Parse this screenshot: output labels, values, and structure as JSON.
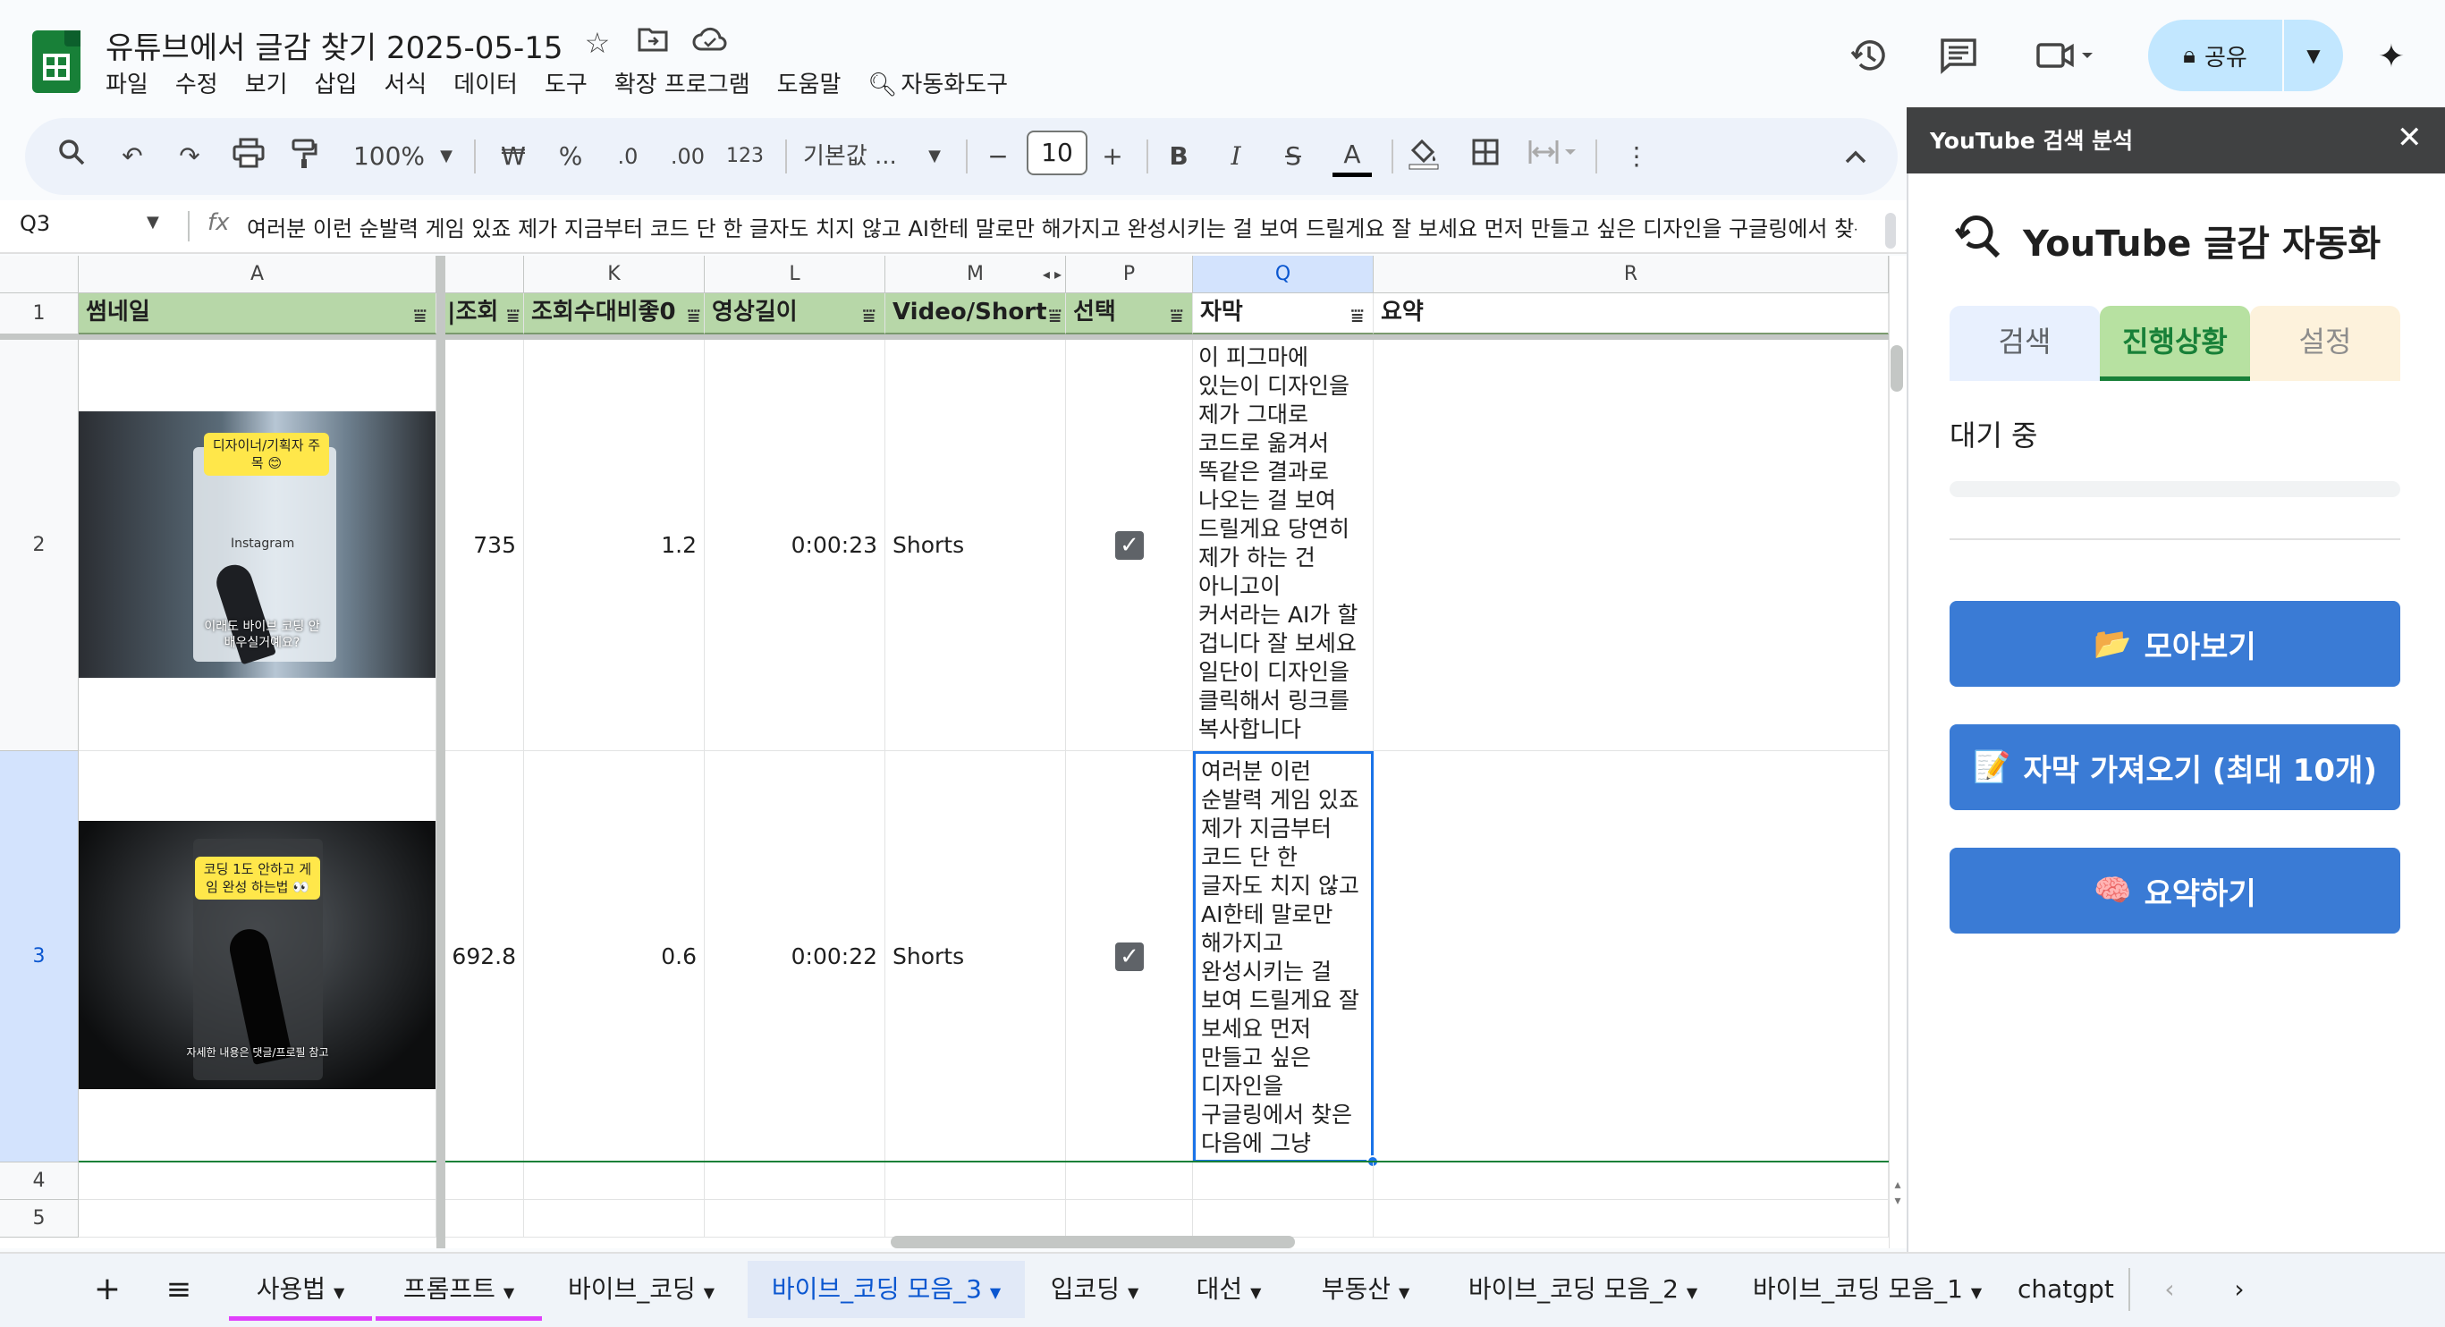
{
  "app": {
    "doc_title": "유튜브에서 글감 찾기 2025-05-15",
    "menu": [
      "파일",
      "수정",
      "보기",
      "삽입",
      "서식",
      "데이터",
      "도구",
      "확장 프로그램",
      "도움말",
      "자동화도구"
    ],
    "share_label": "공유"
  },
  "toolbar": {
    "zoom": "100%",
    "currency": "₩",
    "percent": "%",
    "dec_decrease": ".0",
    "dec_increase": ".00",
    "number_format": "123",
    "font": "기본값 ...",
    "font_size": "10",
    "bold": "B",
    "italic": "I",
    "strike": "S",
    "text_color": "A"
  },
  "formula_bar": {
    "cell_ref": "Q3",
    "fx": "fx",
    "content": "여러분 이런 순발력 게임 있죠 제가 지금부터 코드 단 한 글자도 치지 않고 AI한테 말로만 해가지고 완성시키는 걸 보여 드릴게요 잘 보세요 먼저 만들고 싶은 디자인을 구글링에서 찾은 다음에 그냥"
  },
  "columns": [
    "A",
    "K",
    "L",
    "M",
    "P",
    "Q",
    "R"
  ],
  "rows": [
    "1",
    "2",
    "3",
    "4",
    "5"
  ],
  "header_row": {
    "A": "썸네일",
    "J": "|조회",
    "K": "조회수대비좋0",
    "L": "영상길이",
    "M": "Video/Short",
    "P": "선택",
    "Q": "자막",
    "R": "요약"
  },
  "data_rows": [
    {
      "J": "735",
      "K": "1.2",
      "L": "0:00:23",
      "M": "Shorts",
      "P_checked": true,
      "Q": "이 피그마에 있는이 디자인을 제가 그대로 코드로 옮겨서 똑같은 결과로 나오는 걸 보여 드릴게요 당연히 제가 하는 건 아니고이 커서라는 AI가 할 겁니다 잘 보세요 일단이 디자인을 클릭해서 링크를 복사합니다",
      "thumb_badge": "디자이너/기획자 주목 😊",
      "thumb_caption": "이래도 바이브 코딩 안 배우실거예요?",
      "thumb_logo": "Instagram"
    },
    {
      "J": "692.8",
      "K": "0.6",
      "L": "0:00:22",
      "M": "Shorts",
      "P_checked": true,
      "Q": "여러분 이런 순발력 게임 있죠 제가 지금부터 코드 단 한 글자도 치지 않고 AI한테 말로만 해가지고 완성시키는 걸 보여 드릴게요 잘 보세요 먼저 만들고 싶은 디자인을 구글링에서 찾은 다음에 그냥 복사를 합니다",
      "thumb_badge": "코딩 1도 안하고 게임 완성 하는법 👀",
      "thumb_caption": "자세한 내용은 댓글/프로필 참고"
    }
  ],
  "sheet_tabs": [
    "사용법",
    "프롬프트",
    "바이브_코딩",
    "바이브_코딩 모음_3",
    "입코딩",
    "대선",
    "부동산",
    "바이브_코딩 모음_2",
    "바이브_코딩 모음_1",
    "chatgpt"
  ],
  "active_tab": "바이브_코딩 모음_3",
  "colors": {
    "accent": "#0b57d0",
    "header_green": "#b7d7a8",
    "tab_underline": "#e040fb",
    "panel_button": "#3a7bd5"
  },
  "panel": {
    "header": "YouTube 검색 분석",
    "title": "YouTube 글감 자동화",
    "tabs": [
      "검색",
      "진행상황",
      "설정"
    ],
    "active_tab": "진행상황",
    "status": "대기 중",
    "progress": 0,
    "buttons": [
      {
        "icon": "📂",
        "label": "모아보기"
      },
      {
        "icon": "📝",
        "label": "자막 가져오기 (최대 10개)"
      },
      {
        "icon": "🧠",
        "label": "요약하기"
      }
    ]
  }
}
